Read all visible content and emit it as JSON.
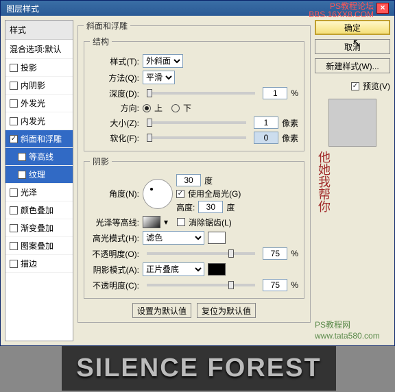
{
  "titlebar": {
    "title": "图层样式"
  },
  "watermark": {
    "line1": "PS教程论坛",
    "line2": "BBS.16XX8.COM"
  },
  "sidebar": {
    "header": "样式",
    "default": "混合选项:默认",
    "items": [
      {
        "label": "投影",
        "checked": false,
        "selected": false,
        "sub": false
      },
      {
        "label": "内阴影",
        "checked": false,
        "selected": false,
        "sub": false
      },
      {
        "label": "外发光",
        "checked": false,
        "selected": false,
        "sub": false
      },
      {
        "label": "内发光",
        "checked": false,
        "selected": false,
        "sub": false
      },
      {
        "label": "斜面和浮雕",
        "checked": true,
        "selected": true,
        "sub": false
      },
      {
        "label": "等高线",
        "checked": false,
        "selected": true,
        "sub": true
      },
      {
        "label": "纹理",
        "checked": false,
        "selected": true,
        "sub": true
      },
      {
        "label": "光泽",
        "checked": false,
        "selected": false,
        "sub": false
      },
      {
        "label": "颜色叠加",
        "checked": false,
        "selected": false,
        "sub": false
      },
      {
        "label": "渐变叠加",
        "checked": false,
        "selected": false,
        "sub": false
      },
      {
        "label": "图案叠加",
        "checked": false,
        "selected": false,
        "sub": false
      },
      {
        "label": "描边",
        "checked": false,
        "selected": false,
        "sub": false
      }
    ]
  },
  "panel": {
    "title": "斜面和浮雕",
    "structure": {
      "legend": "结构",
      "style_lbl": "样式(T):",
      "style_val": "外斜面",
      "tech_lbl": "方法(Q):",
      "tech_val": "平滑",
      "depth_lbl": "深度(D):",
      "depth_val": "1",
      "depth_unit": "%",
      "dir_lbl": "方向:",
      "dir_up": "上",
      "dir_down": "下",
      "size_lbl": "大小(Z):",
      "size_val": "1",
      "size_unit": "像素",
      "soften_lbl": "软化(F):",
      "soften_val": "0",
      "soften_unit": "像素"
    },
    "shading": {
      "legend": "阴影",
      "angle_lbl": "角度(N):",
      "angle_val": "30",
      "angle_unit": "度",
      "global_lbl": "使用全局光(G)",
      "alt_lbl": "高度:",
      "alt_val": "30",
      "alt_unit": "度",
      "gloss_lbl": "光泽等高线:",
      "anti_lbl": "消除锯齿(L)",
      "hi_mode_lbl": "高光模式(H):",
      "hi_mode_val": "滤色",
      "hi_op_lbl": "不透明度(O):",
      "hi_op_val": "75",
      "hi_op_unit": "%",
      "sh_mode_lbl": "阴影模式(A):",
      "sh_mode_val": "正片叠底",
      "sh_op_lbl": "不透明度(C):",
      "sh_op_val": "75",
      "sh_op_unit": "%"
    },
    "buttons": {
      "default": "设置为默认值",
      "reset": "复位为默认值"
    }
  },
  "right": {
    "ok": "确定",
    "cancel": "取消",
    "new_style": "新建样式(W)...",
    "preview_lbl": "预览(V)",
    "site1": "PS教程网",
    "site2": "www.tata580.com",
    "deco": "他她我帮你"
  },
  "footer": {
    "text": "SILENCE FOREST"
  }
}
